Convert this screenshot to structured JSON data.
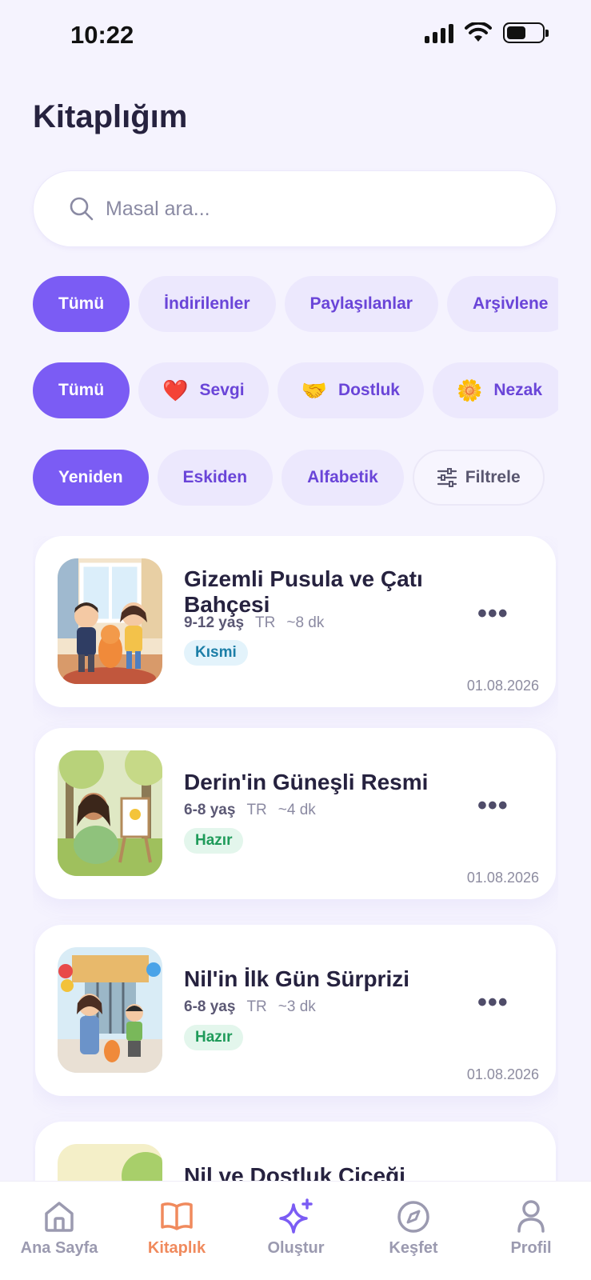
{
  "status_bar": {
    "time": "10:22"
  },
  "page": {
    "title": "Kitaplığım"
  },
  "search": {
    "placeholder": "Masal ara..."
  },
  "source_filters": [
    "Tümü",
    "İndirilenler",
    "Paylaşılanlar",
    "Arşivlene"
  ],
  "theme_filters": [
    {
      "emoji": "",
      "label": "Tümü"
    },
    {
      "emoji": "❤️",
      "label": "Sevgi"
    },
    {
      "emoji": "🤝",
      "label": "Dostluk"
    },
    {
      "emoji": "🌼",
      "label": "Nezak"
    }
  ],
  "sort_options": [
    "Yeniden",
    "Eskiden",
    "Alfabetik"
  ],
  "filter_button": {
    "label": "Filtrele",
    "icon": "sliders-icon"
  },
  "stories": [
    {
      "title": "Gizemli Pusula ve Çatı Bahçesi",
      "age": "9-12 yaş",
      "lang": "TR",
      "duration": "~8 dk",
      "status": "Kısmi",
      "status_type": "partial",
      "date": "01.08.2026",
      "more": "•••"
    },
    {
      "title": "Derin'in Güneşli Resmi",
      "age": "6-8 yaş",
      "lang": "TR",
      "duration": "~4 dk",
      "status": "Hazır",
      "status_type": "ready",
      "date": "01.08.2026",
      "more": "•••"
    },
    {
      "title": "Nil'in İlk Gün Sürprizi",
      "age": "6-8 yaş",
      "lang": "TR",
      "duration": "~3 dk",
      "status": "Hazır",
      "status_type": "ready",
      "date": "01.08.2026",
      "more": "•••"
    },
    {
      "title": "Nil ve Dostluk Çiçeği",
      "age": "",
      "lang": "",
      "duration": "",
      "status": "",
      "status_type": "",
      "date": "",
      "more": ""
    }
  ],
  "tabbar": [
    {
      "label": "Ana Sayfa",
      "icon": "home-icon"
    },
    {
      "label": "Kitaplık",
      "icon": "book-icon",
      "active": true
    },
    {
      "label": "Oluştur",
      "icon": "sparkle-icon"
    },
    {
      "label": "Keşfet",
      "icon": "compass-icon"
    },
    {
      "label": "Profil",
      "icon": "person-icon"
    }
  ],
  "colors": {
    "accent": "#7b5cf4",
    "active_tab": "#f08a5d",
    "background": "#f5f3fe"
  }
}
